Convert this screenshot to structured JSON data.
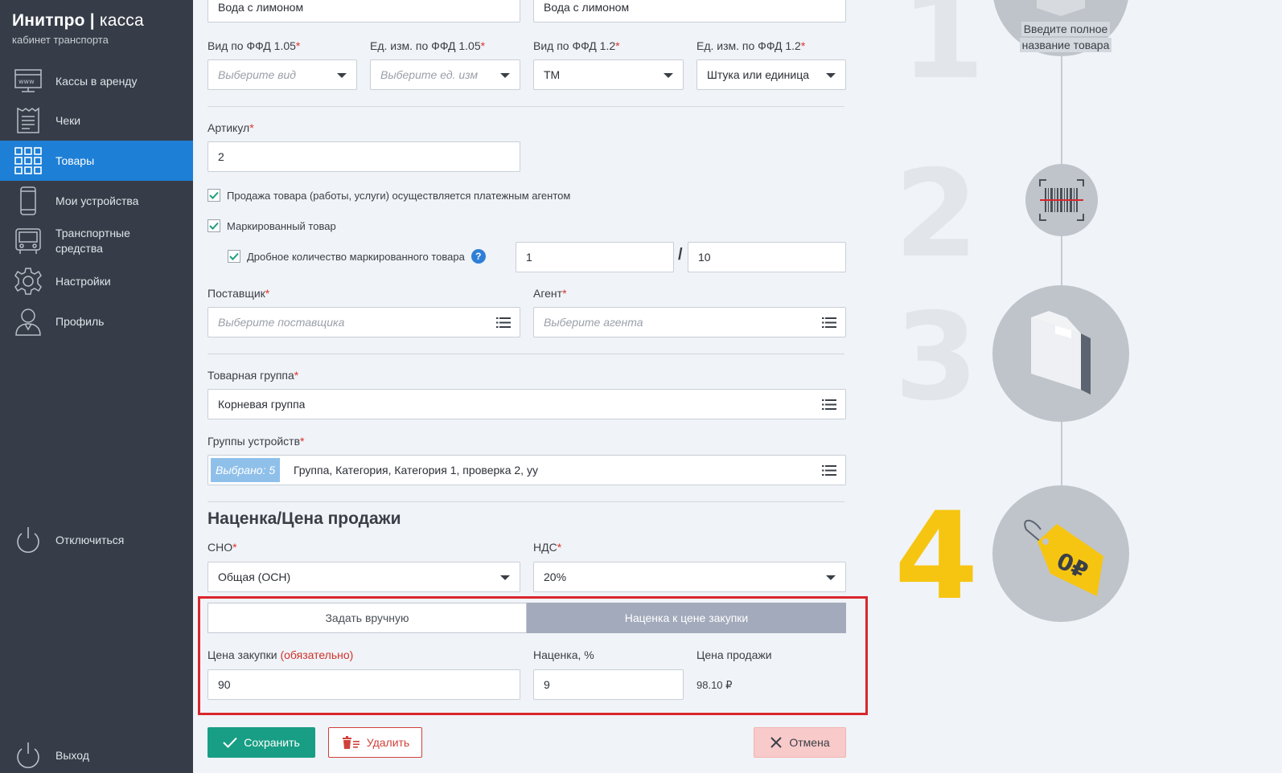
{
  "sidebar": {
    "brand_main": "Инитпро",
    "brand_sep": " | ",
    "brand_light": "касса",
    "brand_sub": "кабинет транспорта",
    "items": [
      {
        "label": "Кассы в аренду",
        "icon": "www-monitor-icon"
      },
      {
        "label": "Чеки",
        "icon": "receipt-icon"
      },
      {
        "label": "Товары",
        "icon": "grid-icon",
        "active": true
      },
      {
        "label": "Мои устройства",
        "icon": "phone-icon"
      },
      {
        "label": "Транспортные средства",
        "icon": "bus-icon"
      },
      {
        "label": "Настройки",
        "icon": "gear-icon"
      },
      {
        "label": "Профиль",
        "icon": "user-icon"
      }
    ],
    "disconnect": "Отключиться",
    "logout": "Выход"
  },
  "form": {
    "name1": "Вода с лимоном",
    "name2": "Вода с лимоном",
    "ffd105_type_label": "Вид по ФФД 1.05",
    "ffd105_type_ph": "Выберите вид",
    "ffd105_unit_label": "Ед. изм. по ФФД 1.05",
    "ffd105_unit_ph": "Выберите ед. изм",
    "ffd12_type_label": "Вид по ФФД 1.2",
    "ffd12_type_val": "ТМ",
    "ffd12_unit_label": "Ед. изм. по ФФД 1.2",
    "ffd12_unit_val": "Штука или единица",
    "article_label": "Артикул",
    "article_val": "2",
    "agent_sale_label": "Продажа товара (работы, услуги) осуществляется платежным агентом",
    "marked_label": "Маркированный товар",
    "fraction_label": "Дробное количество маркированного товара",
    "fraction_num": "1",
    "fraction_sep": "/",
    "fraction_den": "10",
    "supplier_label": "Поставщик",
    "supplier_ph": "Выберите поставщика",
    "agent_label": "Агент",
    "agent_ph": "Выберите агента",
    "group_label": "Товарная группа",
    "group_val": "Корневая группа",
    "device_groups_label": "Группы устройств",
    "device_groups_badge": "Выбрано: 5",
    "device_groups_val": "Группа, Категория, Категория 1, проверка 2, уу",
    "pricing_title": "Наценка/Цена продажи",
    "sno_label": "СНО",
    "sno_val": "Общая (ОСН)",
    "vat_label": "НДС",
    "vat_val": "20%",
    "toggle_manual": "Задать вручную",
    "toggle_markup": "Наценка к цене закупки",
    "purchase_label": "Цена закупки",
    "purchase_req": "(обязательно)",
    "purchase_val": "90",
    "markup_label": "Наценка, %",
    "markup_val": "9",
    "sale_label": "Цена продажи",
    "sale_val": "98.10 ₽",
    "save": "Сохранить",
    "delete": "Удалить",
    "cancel": "Отмена",
    "required_mark": "*"
  },
  "steps": {
    "n1": "1",
    "n2": "2",
    "n3": "3",
    "n4": "4",
    "tip_line1": "Введите полное",
    "tip_line2": "название товара",
    "price_tag": "0₽"
  },
  "colors": {
    "sidebar_bg": "#373d48",
    "active_nav": "#1e7fd6",
    "save_btn": "#189e84",
    "highlight_border": "#d9262c",
    "step_active": "#f6c511"
  }
}
